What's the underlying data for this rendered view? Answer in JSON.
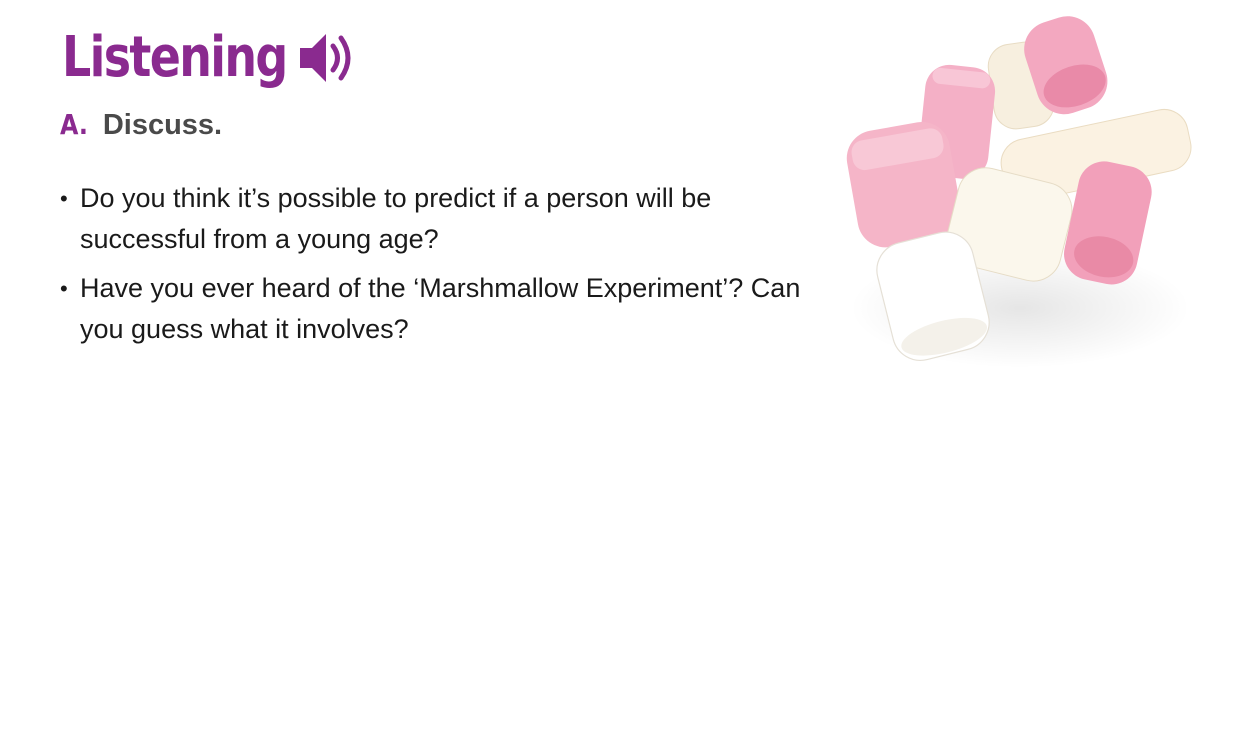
{
  "header": {
    "title": "Listening",
    "audio_icon": "speaker-volume-icon"
  },
  "section": {
    "letter": "A.",
    "title": "Discuss."
  },
  "bullets": [
    {
      "text": "Do you think it’s possible to predict if a person will be successful from a young age?"
    },
    {
      "text": "Have you ever heard of the ‘Marshmallow Experiment’? Can you guess what it involves?"
    }
  ],
  "image": {
    "subject": "marshmallows-photo"
  },
  "colors": {
    "accent": "#8a2a8f",
    "heading_gray": "#4a4a4a",
    "body_text": "#1a1a1a",
    "pink": "#f2a3bd",
    "cream": "#fbf4e6",
    "white": "#ffffff"
  }
}
